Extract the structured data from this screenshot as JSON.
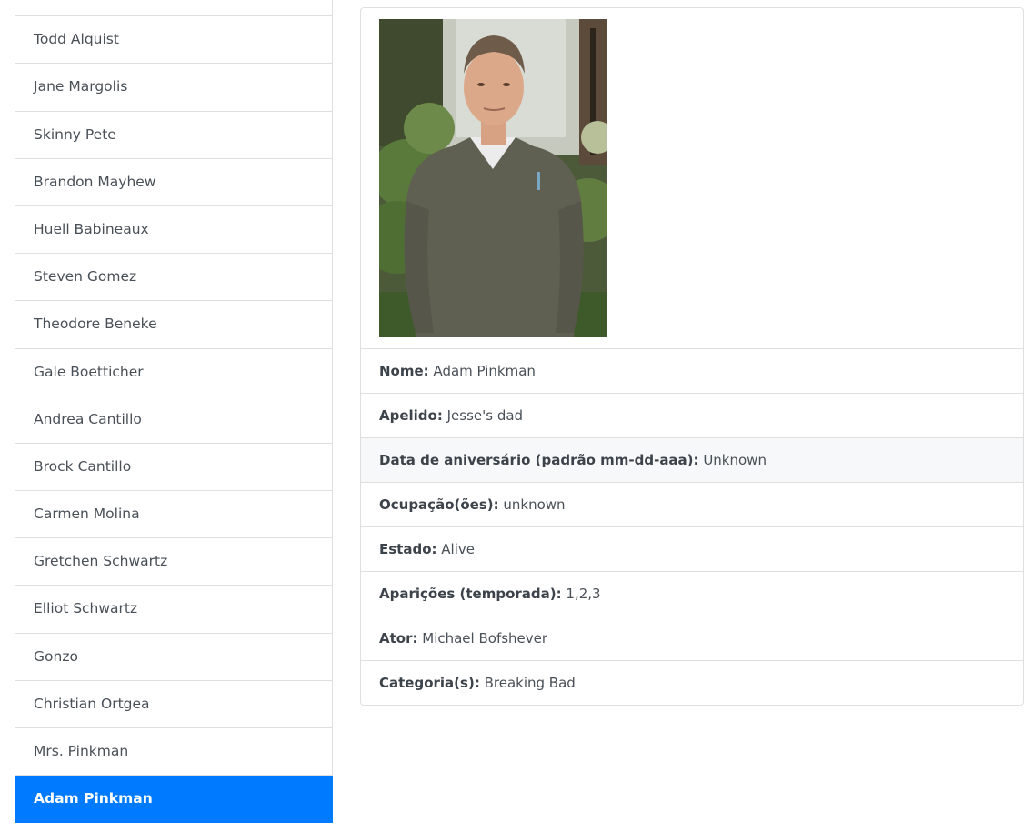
{
  "characters": [
    {
      "name": ""
    },
    {
      "name": "Todd Alquist"
    },
    {
      "name": "Jane Margolis"
    },
    {
      "name": "Skinny Pete"
    },
    {
      "name": "Brandon Mayhew"
    },
    {
      "name": "Huell Babineaux"
    },
    {
      "name": "Steven Gomez"
    },
    {
      "name": "Theodore Beneke"
    },
    {
      "name": "Gale Boetticher"
    },
    {
      "name": "Andrea Cantillo"
    },
    {
      "name": "Brock Cantillo"
    },
    {
      "name": "Carmen Molina"
    },
    {
      "name": "Gretchen Schwartz"
    },
    {
      "name": "Elliot Schwartz"
    },
    {
      "name": "Gonzo"
    },
    {
      "name": "Christian Ortgea"
    },
    {
      "name": "Mrs. Pinkman"
    },
    {
      "name": "Adam Pinkman",
      "active": true
    }
  ],
  "detail": {
    "nome": {
      "label": "Nome:",
      "value": " Adam Pinkman"
    },
    "apelido": {
      "label": "Apelido:",
      "value": " Jesse's dad"
    },
    "aniversario": {
      "label": "Data de aniversário (padrão mm-dd-aaa):",
      "value": " Unknown"
    },
    "ocupacao": {
      "label": "Ocupação(ões):",
      "value": " unknown"
    },
    "estado": {
      "label": "Estado:",
      "value": " Alive"
    },
    "aparicoes": {
      "label": "Aparições (temporada):",
      "value": " 1,2,3"
    },
    "ator": {
      "label": "Ator:",
      "value": " Michael Bofshever"
    },
    "categoria": {
      "label": "Categoria(s):",
      "value": " Breaking Bad"
    }
  },
  "colors": {
    "active": "#007bff",
    "border": "#dfdfdf",
    "text": "#495057"
  }
}
